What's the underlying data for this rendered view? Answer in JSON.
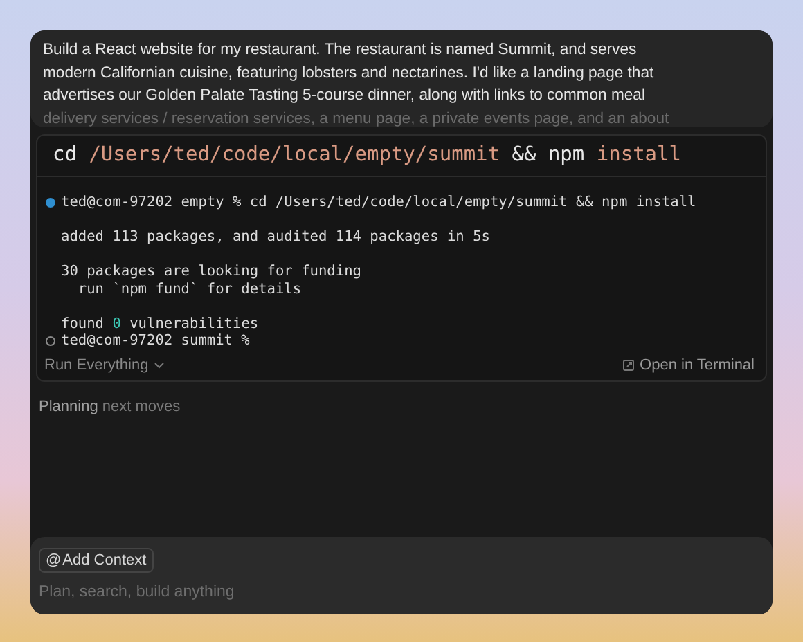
{
  "prompt": {
    "lines": [
      "Build a React website for my restaurant. The restaurant is named Summit, and serves",
      "modern Californian cuisine, featuring lobsters and nectarines. I'd like a landing page that",
      "advertises our Golden Palate Tasting 5-course dinner, along with links to common meal"
    ],
    "faded_line": "delivery services / reservation services, a menu page, a private events page, and an about"
  },
  "terminal": {
    "command": [
      {
        "text": "cd",
        "kind": "plain"
      },
      {
        "text": "/Users/ted/code/local/empty/summit",
        "kind": "arg"
      },
      {
        "text": "&&",
        "kind": "plain"
      },
      {
        "text": "npm",
        "kind": "plain"
      },
      {
        "text": "install",
        "kind": "arg"
      }
    ],
    "output_blocks": [
      [
        {
          "kind": "prompt",
          "running": true,
          "segments": [
            {
              "text": "ted@com-97202 empty % cd /Users/ted/code/local/empty/summit && npm install",
              "kind": "plain"
            }
          ]
        }
      ],
      [
        {
          "kind": "output",
          "segments": [
            {
              "text": "added 113 packages, and audited 114 packages in 5s",
              "kind": "plain"
            }
          ]
        }
      ],
      [
        {
          "kind": "output",
          "segments": [
            {
              "text": "30 packages are looking for funding",
              "kind": "plain"
            }
          ]
        },
        {
          "kind": "output",
          "segments": [
            {
              "text": "  run `npm fund` for details",
              "kind": "plain"
            }
          ]
        }
      ],
      [
        {
          "kind": "output",
          "segments": [
            {
              "text": "found ",
              "kind": "plain"
            },
            {
              "text": "0",
              "kind": "highlight"
            },
            {
              "text": " vulnerabilities",
              "kind": "plain"
            }
          ]
        },
        {
          "kind": "prompt",
          "running": false,
          "segments": [
            {
              "text": "ted@com-97202 summit %",
              "kind": "plain"
            }
          ]
        }
      ]
    ],
    "run_mode": "Run Everything",
    "open_link": "Open in Terminal"
  },
  "status": {
    "label": "Planning",
    "detail": "next moves"
  },
  "composer": {
    "context_icon": "@",
    "context_button": "Add Context",
    "placeholder": "Plan, search, build anything"
  }
}
